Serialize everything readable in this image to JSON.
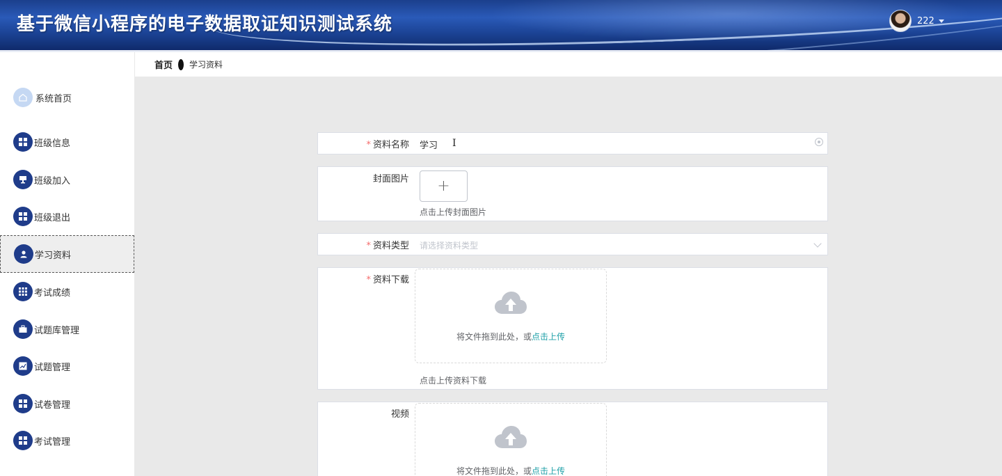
{
  "header": {
    "title": "基于微信小程序的电子数据取证知识测试系统",
    "username": "222"
  },
  "breadcrumb": {
    "home": "首页",
    "current": "学习资料"
  },
  "sidebar": {
    "items": [
      {
        "label": "系统首页",
        "icon": "home-icon"
      },
      {
        "label": "班级信息",
        "icon": "grid-icon"
      },
      {
        "label": "班级加入",
        "icon": "monitor-icon"
      },
      {
        "label": "班级退出",
        "icon": "grid-icon"
      },
      {
        "label": "学习资料",
        "icon": "user-icon",
        "active": true
      },
      {
        "label": "考试成绩",
        "icon": "table-icon"
      },
      {
        "label": "试题库管理",
        "icon": "briefcase-icon"
      },
      {
        "label": "试题管理",
        "icon": "chart-icon"
      },
      {
        "label": "试卷管理",
        "icon": "grid-icon"
      },
      {
        "label": "考试管理",
        "icon": "grid-icon"
      }
    ]
  },
  "form": {
    "name_label": "资料名称",
    "name_value": "学习",
    "cover_label": "封面图片",
    "cover_plus": "+",
    "cover_hint": "点击上传封面图片",
    "type_label": "资料类型",
    "type_placeholder": "请选择资料类型",
    "download_label": "资料下载",
    "drag_text": "将文件拖到此处，或",
    "drag_link": "点击上传",
    "download_hint": "点击上传资料下载",
    "video_label": "视频"
  },
  "colors": {
    "header": "#1c4496",
    "menu_icon": "#1f3c8a",
    "required": "#f56c6c",
    "link": "#1fa0a8"
  }
}
